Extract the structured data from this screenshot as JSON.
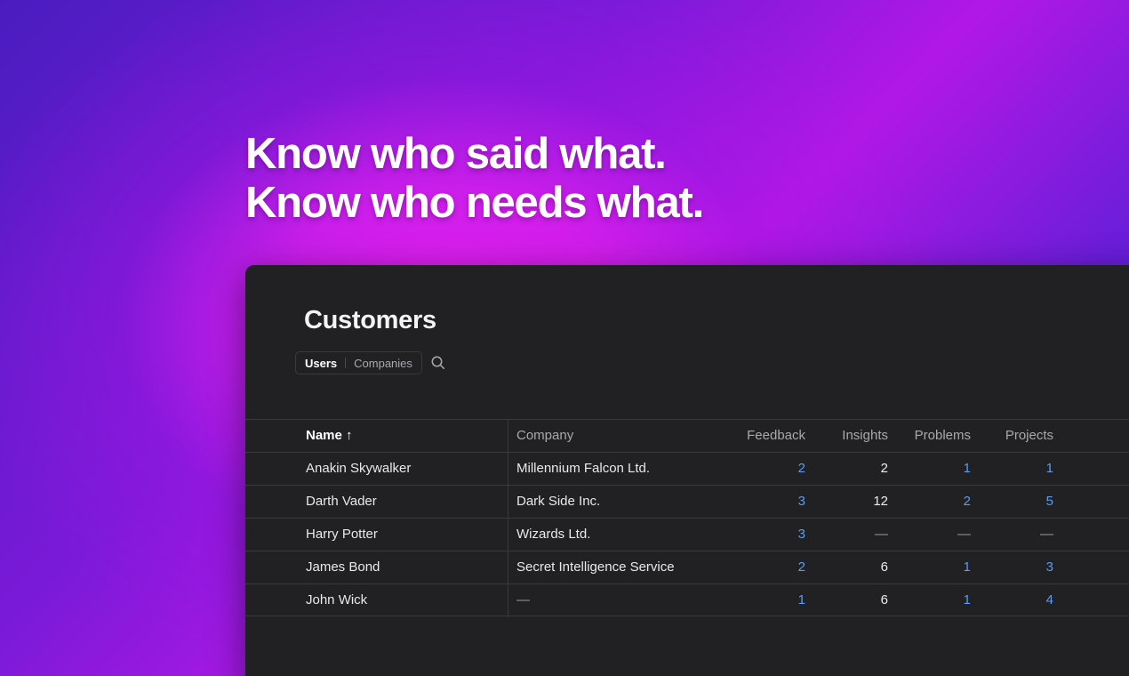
{
  "headline": {
    "line1": "Know who said what.",
    "line2": "Know who needs what."
  },
  "panel": {
    "title": "Customers",
    "tabs": [
      {
        "label": "Users",
        "active": true
      },
      {
        "label": "Companies",
        "active": false
      }
    ],
    "search_icon": "search-icon"
  },
  "table": {
    "columns": {
      "name": "Name ↑",
      "company": "Company",
      "feedback": "Feedback",
      "insights": "Insights",
      "problems": "Problems",
      "projects": "Projects"
    },
    "rows": [
      {
        "name": "Anakin Skywalker",
        "company": "Millennium Falcon Ltd.",
        "feedback": "2",
        "insights": "2",
        "problems": "1",
        "projects": "1"
      },
      {
        "name": "Darth Vader",
        "company": "Dark Side Inc.",
        "feedback": "3",
        "insights": "12",
        "problems": "2",
        "projects": "5"
      },
      {
        "name": "Harry Potter",
        "company": "Wizards Ltd.",
        "feedback": "3",
        "insights": "—",
        "problems": "—",
        "projects": "—"
      },
      {
        "name": "James Bond",
        "company": "Secret Intelligence Service",
        "feedback": "2",
        "insights": "6",
        "problems": "1",
        "projects": "3"
      },
      {
        "name": "John Wick",
        "company": "—",
        "feedback": "1",
        "insights": "6",
        "problems": "1",
        "projects": "4"
      }
    ]
  },
  "colors": {
    "link": "#5b9cf2",
    "panel_bg": "#212023",
    "accent_magenta": "#e61ff0"
  }
}
